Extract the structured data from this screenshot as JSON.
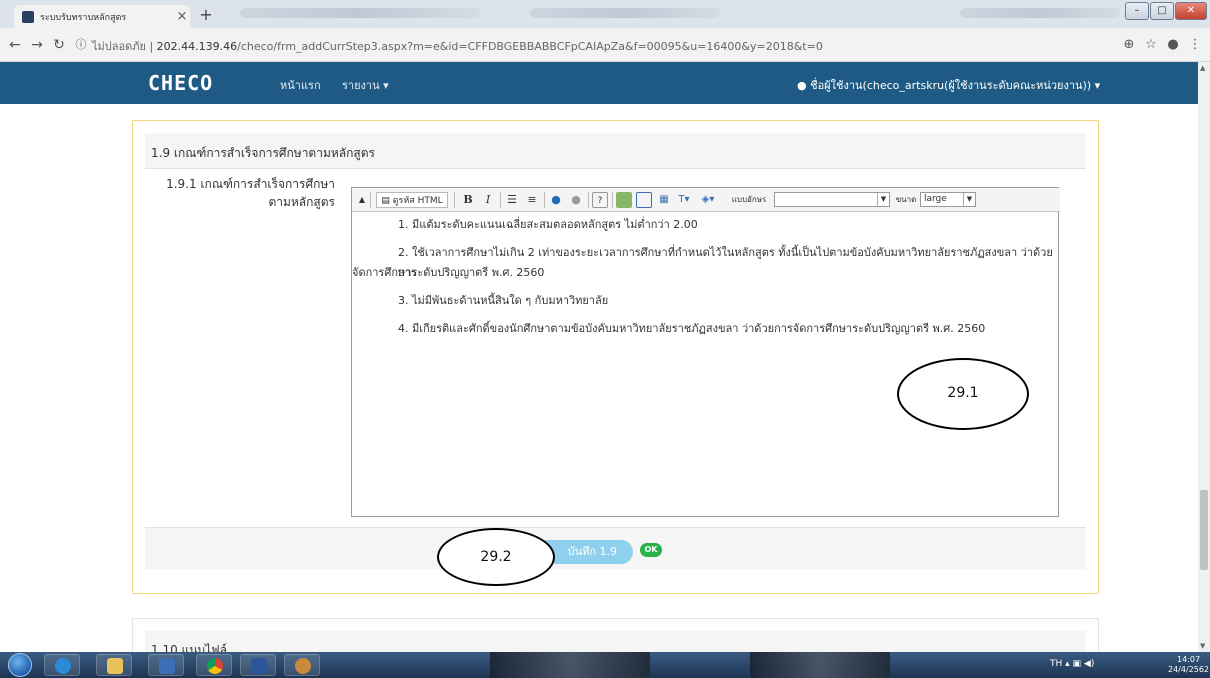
{
  "browser": {
    "tab_title": "ระบบรับทราบหลักสูตร",
    "tab_close": "×",
    "new_tab": "+",
    "security_label": "ไม่ปลอดภัย",
    "url_host": "202.44.139.46",
    "url_path": "/checo/frm_addCurrStep3.aspx?m=e&id=CFFDBGEBBABBCFpCAIApZa&f=00095&u=16400&y=2018&t=0"
  },
  "navbar": {
    "brand": "CHECO",
    "home": "หน้าแรก",
    "report": "รายงาน ▾",
    "user": "ชื่อผู้ใช้งาน(checo_artskru(ผู้ใช้งานระดับคณะหน่วยงาน)) ▾"
  },
  "section": {
    "heading": "1.9 เกณฑ์การสำเร็จการศึกษาตามหลักสูตร",
    "field_label_line1": "1.9.1 เกณฑ์การสำเร็จการศึกษา",
    "field_label_line2": "ตามหลักสูตร"
  },
  "editor": {
    "html_button": "ดูรหัส HTML",
    "bold": "B",
    "italic": "I",
    "font_label": "แบบอักษร",
    "size_label": "ขนาด",
    "size_value": "large",
    "paragraphs": [
      "1. มีแต้มระดับคะแนนเฉลี่ยสะสมตลอดหลักสูตร ไม่ต่ำกว่า 2.00",
      "2. ใช้เวลาการศึกษาไม่เกิน 2 เท่าของระยะเวลาการศึกษาที่กำหนดไว้ในหลักสูตร ทั้งนี้เป็นไปตามข้อบังคับมหาวิทยาลัยราชภัฏสงขลา ว่าด้วยการ",
      "จัดการศึกษาระดับปริญญาตรี พ.ศ. 2560",
      "3. ไม่มีพันธะด้านหนี้สินใด ๆ กับมหาวิทยาลัย",
      "4. มีเกียรติและศักดิ์ของนักศึกษาตามข้อบังคับมหาวิทยาลัยราชภัฏสงขลา ว่าด้วยการจัดการศึกษาระดับปริญญาตรี พ.ศ. 2560"
    ]
  },
  "actions": {
    "save_label": "บันทึก 1.9",
    "ok_badge": "OK"
  },
  "next_section": {
    "heading": "1.10 แนบไฟล์"
  },
  "annotations": {
    "a1": "29.1",
    "a2": "29.2"
  },
  "taskbar": {
    "lang": "TH",
    "time": "14:07",
    "date": "24/4/2562"
  }
}
